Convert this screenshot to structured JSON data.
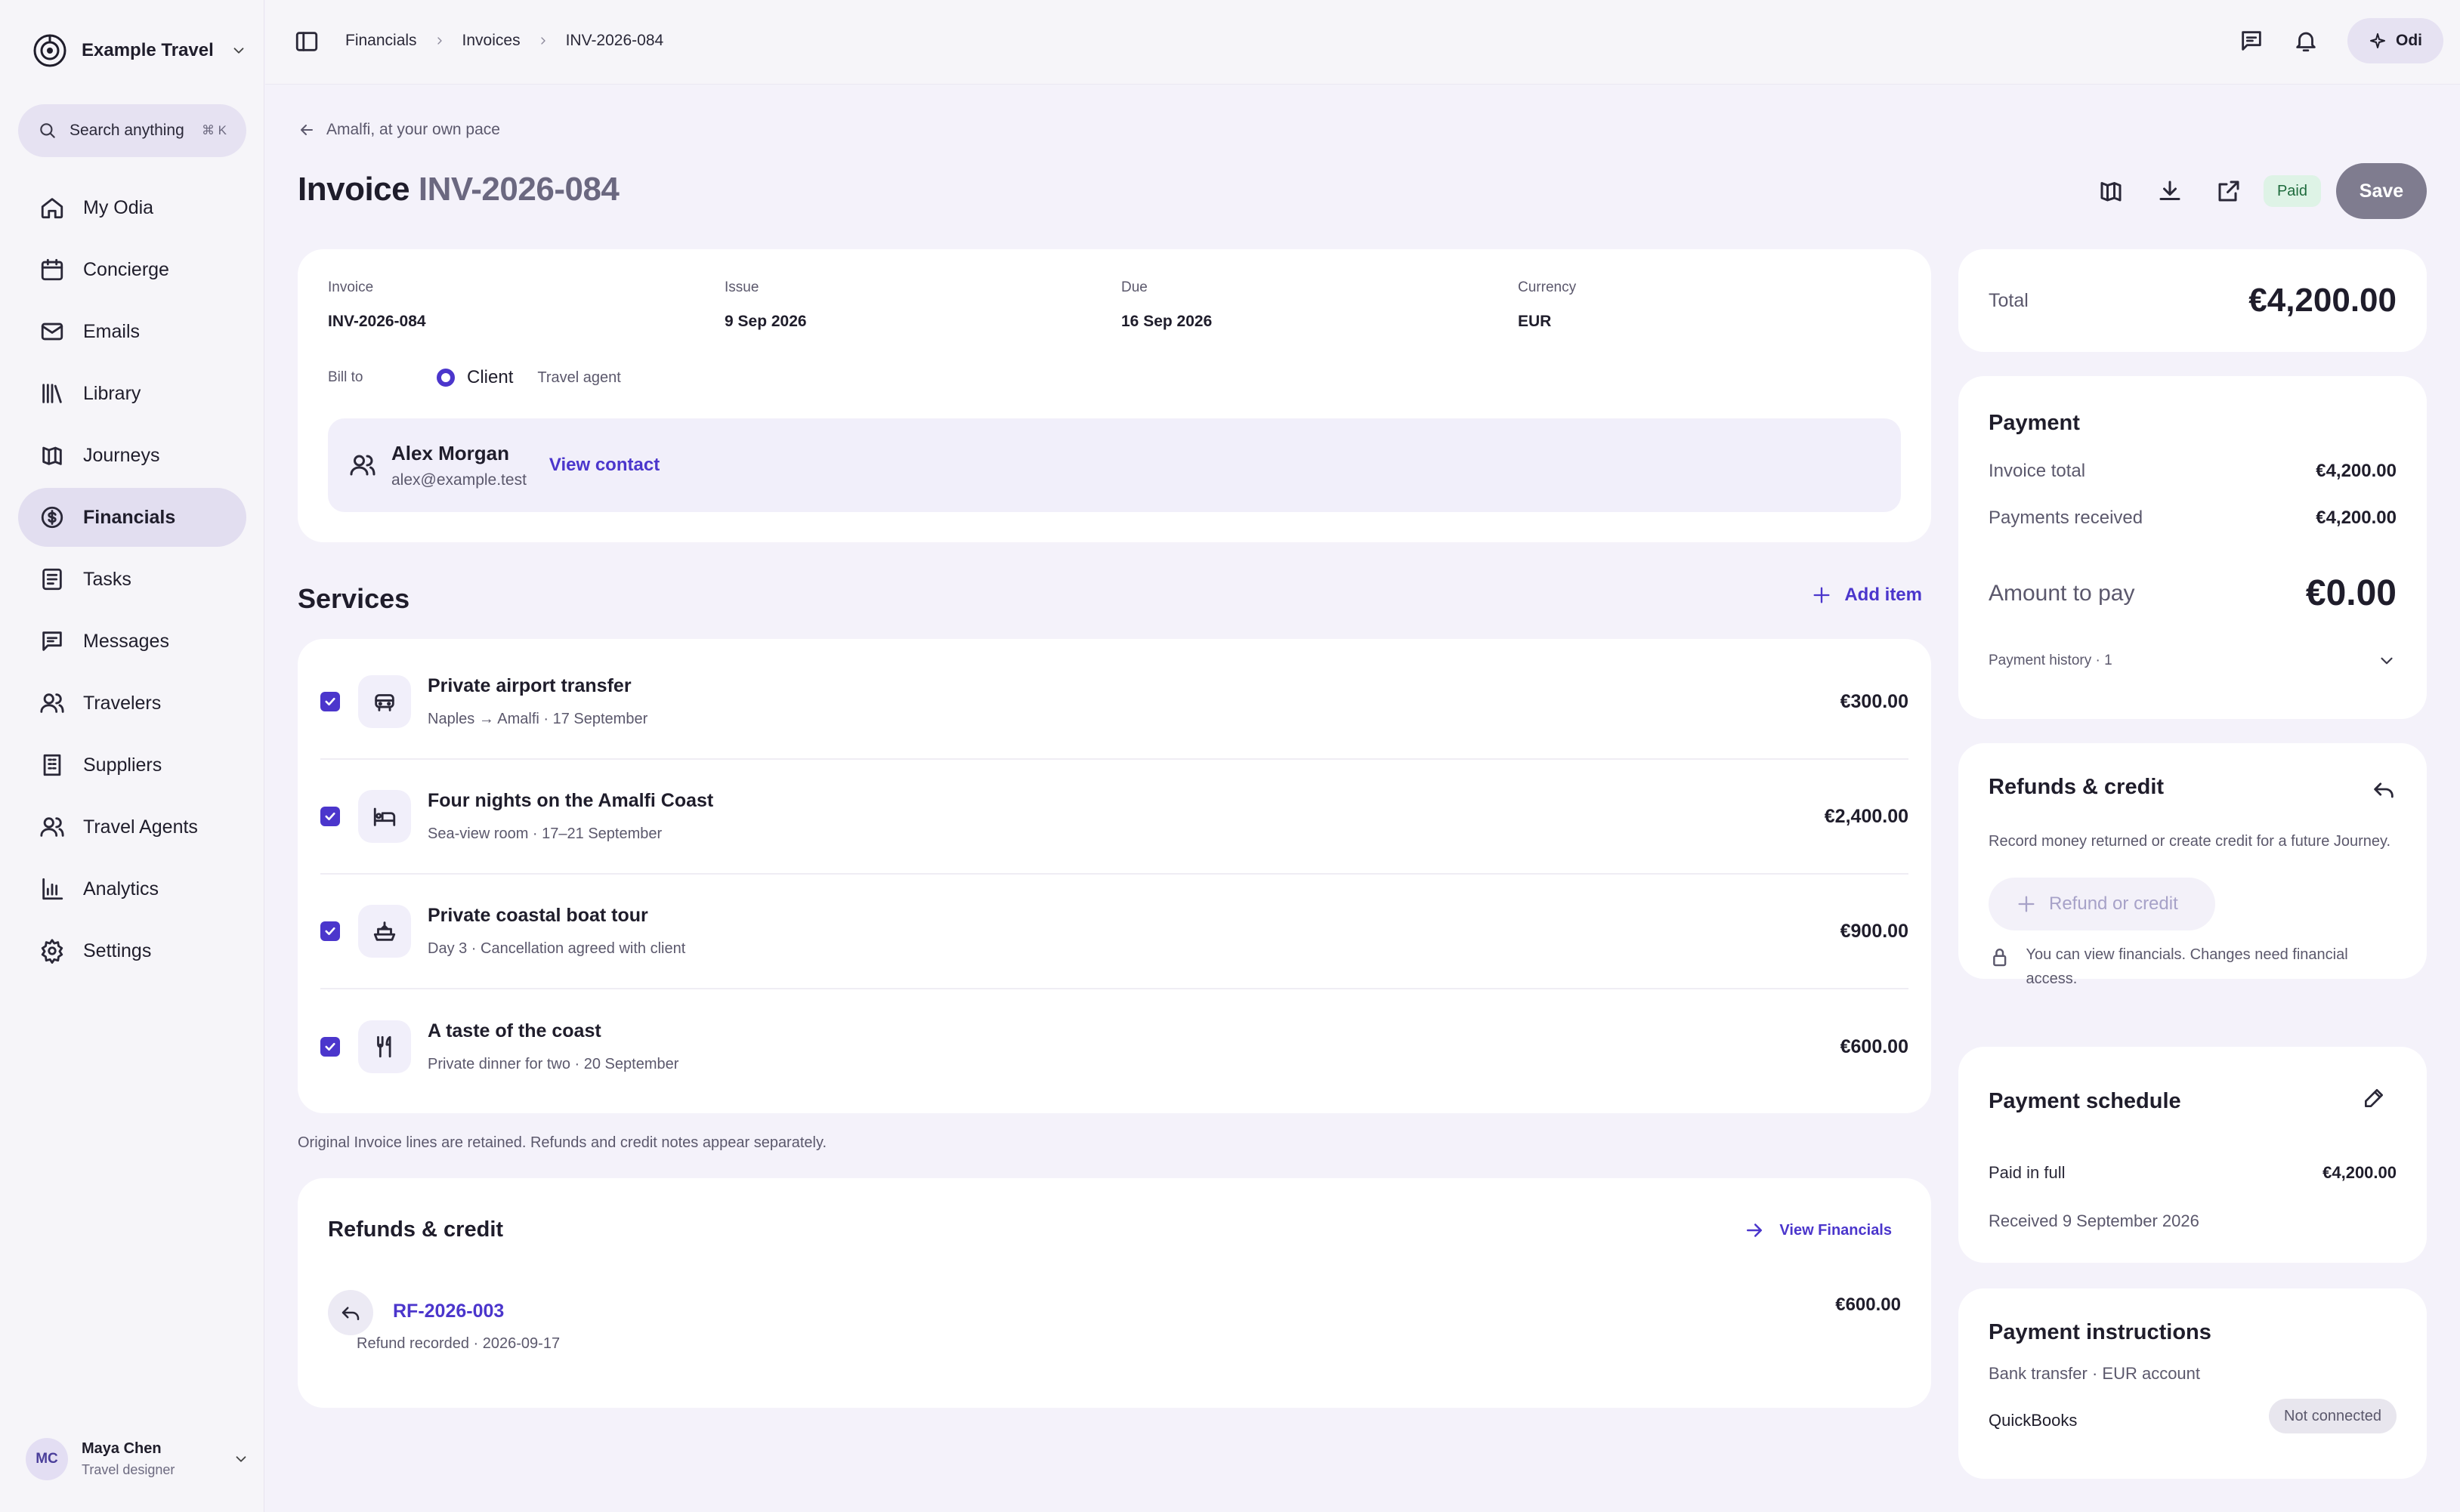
{
  "brand": {
    "name": "Example Travel"
  },
  "search": {
    "label": "Search anything",
    "shortcut": "⌘ K"
  },
  "nav": [
    {
      "label": "My Odia",
      "icon": "home-icon"
    },
    {
      "label": "Concierge",
      "icon": "calendar-icon"
    },
    {
      "label": "Emails",
      "icon": "mail-icon"
    },
    {
      "label": "Library",
      "icon": "library-icon"
    },
    {
      "label": "Journeys",
      "icon": "map-icon"
    },
    {
      "label": "Financials",
      "icon": "dollar-icon",
      "active": true
    },
    {
      "label": "Tasks",
      "icon": "tasks-icon"
    },
    {
      "label": "Messages",
      "icon": "message-icon"
    },
    {
      "label": "Travelers",
      "icon": "users-icon"
    },
    {
      "label": "Suppliers",
      "icon": "building-icon"
    },
    {
      "label": "Travel Agents",
      "icon": "agents-icon"
    },
    {
      "label": "Analytics",
      "icon": "chart-icon"
    },
    {
      "label": "Settings",
      "icon": "gear-icon"
    }
  ],
  "user": {
    "initials": "MC",
    "name": "Maya Chen",
    "role": "Travel designer"
  },
  "breadcrumb": [
    "Financials",
    "Invoices",
    "INV-2026-084"
  ],
  "topbar": {
    "assistant": "Odi"
  },
  "back_link": "Amalfi, at your own pace",
  "page": {
    "title_prefix": "Invoice",
    "title_number": "INV-2026-084",
    "status": "Paid",
    "save_label": "Save"
  },
  "invoice": {
    "fields": [
      {
        "label": "Invoice",
        "value": "INV-2026-084"
      },
      {
        "label": "Issue",
        "value": "9 Sep 2026"
      },
      {
        "label": "Due",
        "value": "16 Sep 2026"
      },
      {
        "label": "Currency",
        "value": "EUR"
      }
    ],
    "bill_to_label": "Bill to",
    "bill_to_selected": "Client",
    "bill_to_other": "Travel agent",
    "contact": {
      "name": "Alex Morgan",
      "email": "alex@example.test",
      "view_label": "View contact"
    }
  },
  "services": {
    "heading": "Services",
    "add_label": "Add item",
    "items": [
      {
        "title": "Private airport transfer",
        "subtitle": "Naples → Amalfi · 17 September",
        "price": "€300.00",
        "icon": "car-icon"
      },
      {
        "title": "Four nights on the Amalfi Coast",
        "subtitle": "Sea-view room · 17–21 September",
        "price": "€2,400.00",
        "icon": "bed-icon"
      },
      {
        "title": "Private coastal boat tour",
        "subtitle": "Day 3 · Cancellation agreed with client",
        "price": "€900.00",
        "icon": "boat-icon"
      },
      {
        "title": "A taste of the coast",
        "subtitle": "Private dinner for two · 20 September",
        "price": "€600.00",
        "icon": "cutlery-icon"
      }
    ],
    "note": "Original Invoice lines are retained. Refunds and credit notes appear separately."
  },
  "refunds_section": {
    "heading": "Refunds & credit",
    "link_label": "View Financials",
    "items": [
      {
        "id": "RF-2026-003",
        "subtitle": "Refund recorded · 2026-09-17",
        "amount": "€600.00"
      }
    ]
  },
  "total": {
    "label": "Total",
    "value": "€4,200.00"
  },
  "payment": {
    "heading": "Payment",
    "invoice_total_label": "Invoice total",
    "invoice_total": "€4,200.00",
    "received_label": "Payments received",
    "received": "€4,200.00",
    "amount_label": "Amount to pay",
    "amount": "€0.00",
    "history_label": "Payment history · 1"
  },
  "refund_panel": {
    "heading": "Refunds & credit",
    "description": "Record money returned or create credit for a future Journey.",
    "button": "Refund or credit",
    "lock_note": "You can view financials. Changes need financial access."
  },
  "schedule": {
    "heading": "Payment schedule",
    "label": "Paid in full",
    "amount": "€4,200.00",
    "received": "Received 9 September 2026"
  },
  "instructions": {
    "heading": "Payment instructions",
    "subtitle": "Bank transfer · EUR account",
    "integration": "QuickBooks",
    "integration_status": "Not connected"
  },
  "colors": {
    "accent": "#4b36cc",
    "paid_bg": "#def3e6",
    "paid_text": "#1f6b3d",
    "nav_active": "#e2def0"
  }
}
